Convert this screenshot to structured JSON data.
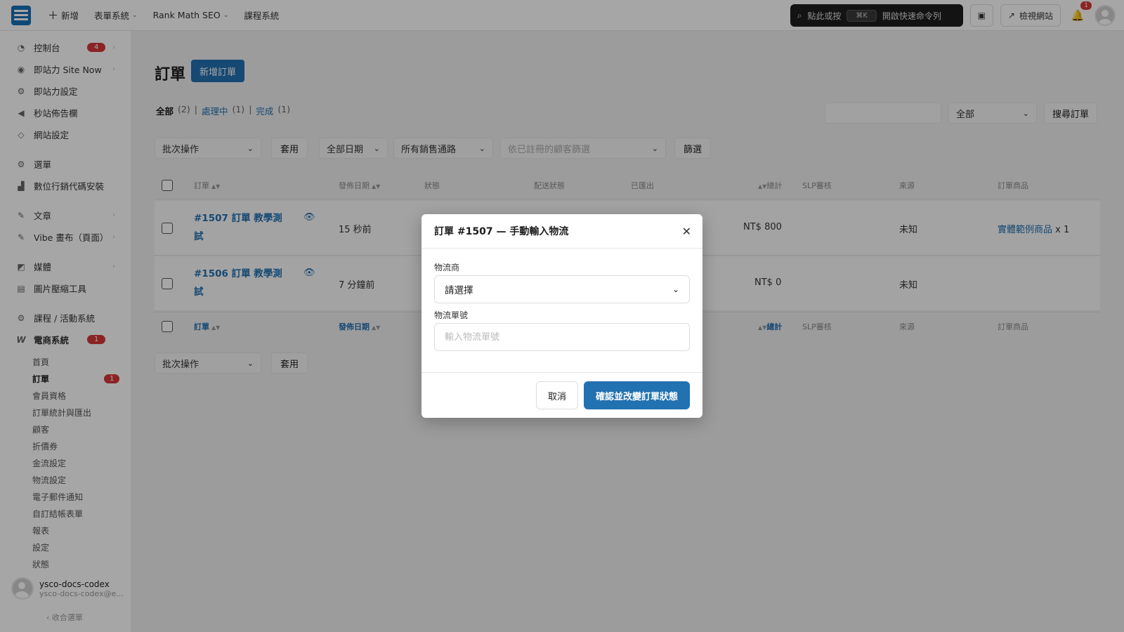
{
  "topbar": {
    "items": [
      {
        "label": "新增",
        "icon": "plus-icon"
      },
      {
        "label": "表單系統",
        "has_menu": true
      },
      {
        "label": "Rank Math SEO",
        "has_menu": true
      },
      {
        "label": "課程系統",
        "has_menu": false
      }
    ],
    "command_palette": {
      "left": "點此或按",
      "shortcut": "⌘K",
      "right": "開啟快速命令列"
    },
    "view_site": "檢視網站",
    "notifications_count": "1"
  },
  "sidebar": {
    "items": [
      {
        "label": "控制台",
        "icon": "dashboard-icon",
        "count": "4",
        "arrow": true
      },
      {
        "label": "即站力 Site Now",
        "icon": "site-now-icon",
        "arrow": true
      },
      {
        "label": "即站力設定",
        "icon": "gear-icon"
      },
      {
        "label": "秒站佈告欄",
        "icon": "megaphone-icon"
      },
      {
        "label": "網站設定",
        "icon": "site-settings-icon"
      },
      {
        "label": "選單",
        "icon": "menu-gear-icon"
      },
      {
        "label": "數位行銷代碼安裝",
        "icon": "chart-icon"
      },
      {
        "label": "文章",
        "icon": "pin-icon",
        "arrow": true
      },
      {
        "label": "Vibe 畫布（頁面）",
        "icon": "pin-icon",
        "arrow": true
      },
      {
        "label": "媒體",
        "icon": "media-icon",
        "arrow": true
      },
      {
        "label": "圖片壓縮工具",
        "icon": "image-icon"
      },
      {
        "label": "課程 / 活動系統",
        "icon": "course-gear-icon"
      },
      {
        "label": "電商系統",
        "icon": "woo-icon",
        "count": "1"
      }
    ],
    "sub_items": [
      {
        "label": "首頁"
      },
      {
        "label": "訂單",
        "count": "1",
        "active": true
      },
      {
        "label": "會員資格"
      },
      {
        "label": "訂單統計與匯出"
      },
      {
        "label": "顧客"
      },
      {
        "label": "折價券"
      },
      {
        "label": "金流設定"
      },
      {
        "label": "物流設定"
      },
      {
        "label": "電子郵件通知"
      },
      {
        "label": "自訂結帳表單"
      },
      {
        "label": "報表"
      },
      {
        "label": "設定"
      },
      {
        "label": "狀態"
      }
    ],
    "user": {
      "name": "ysco-docs-codex",
      "email": "ysco-docs-codex@e..."
    },
    "collapse": "收合選單"
  },
  "main": {
    "title": "訂單",
    "add_button": "新增訂單",
    "filters": {
      "all": "全部",
      "all_count": "(2)",
      "processing": "處理中",
      "processing_count": "(1)",
      "completed": "完成",
      "completed_count": "(1)",
      "sep": "|"
    },
    "search": {
      "status_select": "全部",
      "button": "搜尋訂單"
    },
    "bulk_action": "批次操作",
    "apply": "套用",
    "date_filter": "全部日期",
    "channel_filter": "所有銷售通路",
    "customer_filter": "依已註冊的顧客篩選",
    "filter_button": "篩選",
    "columns": {
      "order": "訂單",
      "date": "發佈日期",
      "status": "狀態",
      "shipping": "配送狀態",
      "exported": "已匯出",
      "total": "總計",
      "slp": "SLP審核",
      "source": "來源",
      "items": "訂單商品"
    },
    "rows": [
      {
        "order": "#1507 訂單 教學測試",
        "date": "15 秒前",
        "total": "NT$ 800",
        "source": "未知",
        "item_link": "實體範例商品",
        "item_qty": "x 1"
      },
      {
        "order": "#1506 訂單 教學測試",
        "date": "7 分鐘前",
        "total": "NT$ 0",
        "source": "未知",
        "item_link": "",
        "item_qty": ""
      }
    ]
  },
  "modal": {
    "title": "訂單 #1507 — 手動輸入物流",
    "carrier_label": "物流商",
    "carrier_value": "請選擇",
    "tracking_label": "物流單號",
    "tracking_placeholder": "輸入物流單號",
    "cancel": "取消",
    "confirm": "確認並改變訂單狀態"
  },
  "colors": {
    "accent": "#2271b1",
    "badge": "#d63638",
    "dark": "#1e1e1e"
  }
}
